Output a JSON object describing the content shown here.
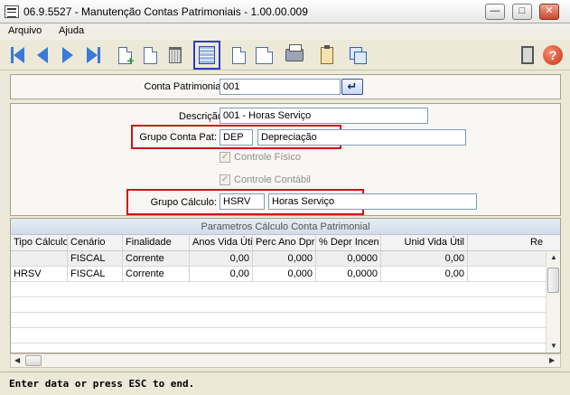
{
  "window": {
    "title": "06.9.5527 - Manutenção Contas Patrimoniais - 1.00.00.009",
    "minimize": "—",
    "maximize": "□",
    "close": "✕"
  },
  "menu": {
    "items": [
      "Arquivo",
      "Ajuda"
    ]
  },
  "toolbar": {
    "icons": [
      "first-record-icon",
      "previous-record-icon",
      "next-record-icon",
      "last-record-icon",
      "new-record-icon",
      "edit-record-icon",
      "delete-record-icon",
      "grid-view-icon",
      "document-icon",
      "search-icon",
      "print-icon",
      "clipboard-icon",
      "copy-icon",
      "exit-icon",
      "help-icon"
    ],
    "help_glyph": "?"
  },
  "header": {
    "conta_label": "Conta Patrimonial:",
    "conta_value": "001",
    "enter_glyph": "↵"
  },
  "form": {
    "descricao_label": "Descrição:",
    "descricao_value": "001 - Horas Serviço",
    "grupo_conta_label": "Grupo Conta Pat:",
    "grupo_conta_code": "DEP",
    "grupo_conta_desc": "Depreciação",
    "controle_fisico_label": "Controle Físico",
    "controle_contabil_label": "Controle Contábil",
    "check_glyph": "✓",
    "grupo_calculo_label": "Grupo Cálculo:",
    "grupo_calculo_code": "HSRV",
    "grupo_calculo_desc": "Horas Serviço"
  },
  "grid": {
    "caption": "Parametros Cálculo Conta Patrimonial",
    "columns": [
      "Tipo Cálculo",
      "Cenário",
      "Finalidade",
      "Anos Vida Útil",
      "Perc Ano Dpr",
      "% Depr Incen",
      "Unid Vida Útil",
      "Re"
    ],
    "rows": [
      [
        "",
        "FISCAL",
        "Corrente",
        "0,00",
        "0,000",
        "0,0000",
        "0,00"
      ],
      [
        "HRSV",
        "FISCAL",
        "Corrente",
        "0,00",
        "0,000",
        "0,0000",
        "0,00"
      ]
    ]
  },
  "status": {
    "text": "Enter data or press ESC to end."
  },
  "colors": {
    "highlight_red": "#D0121B",
    "selected_tool_blue": "#2E3BC6"
  }
}
